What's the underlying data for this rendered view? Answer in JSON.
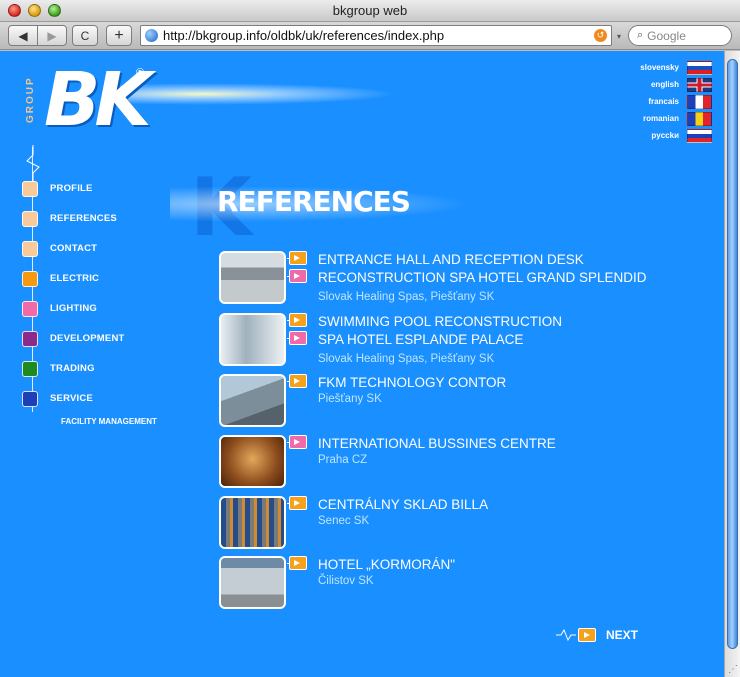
{
  "window": {
    "title": "bkgroup web"
  },
  "toolbar": {
    "back_label": "◀",
    "forward_label": "▶",
    "reload_label": "C",
    "add_label": "+",
    "url": "http://bkgroup.info/oldbk/uk/references/index.php",
    "search_placeholder": "Google"
  },
  "logo": {
    "group": "GROUP",
    "mark": "BK",
    "registered": "®"
  },
  "languages": [
    {
      "label": "slovensky",
      "flag": "flag-sk"
    },
    {
      "label": "english",
      "flag": "flag-gb"
    },
    {
      "label": "francais",
      "flag": "flag-fr"
    },
    {
      "label": "romanian",
      "flag": "flag-ro"
    },
    {
      "label": "pycckи",
      "flag": "flag-ru"
    }
  ],
  "nav": {
    "items": [
      {
        "label": "PROFILE",
        "color": "#f8c99a"
      },
      {
        "label": "REFERENCES",
        "color": "#f8c99a"
      },
      {
        "label": "CONTACT",
        "color": "#f8c99a"
      },
      {
        "label": "ELECTRIC",
        "color": "#f59a10"
      },
      {
        "label": "LIGHTING",
        "color": "#f06aa8"
      },
      {
        "label": "DEVELOPMENT",
        "color": "#8a2a8c"
      },
      {
        "label": "TRADING",
        "color": "#1f8a22"
      },
      {
        "label": "SERVICE",
        "color": "#1d3fb8"
      }
    ],
    "service_sub": "FACILITY MANAGEMENT"
  },
  "heading": {
    "watermark": "K",
    "title": "REFERENCES"
  },
  "references": [
    {
      "lines": [
        "ENTRANCE HALL AND RECEPTION DESK",
        "RECONSTRUCTION SPA HOTEL GRAND SPLENDID"
      ],
      "arrows": [
        "orange",
        "pink"
      ],
      "location": "Slovak Healing Spas, Piešťany SK",
      "thumb": "th1"
    },
    {
      "lines": [
        "SWIMMING POOL RECONSTRUCTION",
        "SPA HOTEL ESPLANDE PALACE"
      ],
      "arrows": [
        "orange",
        "pink"
      ],
      "location": "Slovak Healing Spas, Piešťany SK",
      "thumb": "th2"
    },
    {
      "lines": [
        "FKM TECHNOLOGY CONTOR"
      ],
      "arrows": [
        "orange"
      ],
      "location": "Piešťany SK",
      "thumb": "th3"
    },
    {
      "lines": [
        "INTERNATIONAL BUSSINES CENTRE"
      ],
      "arrows": [
        "pink"
      ],
      "location": "Praha CZ",
      "thumb": "th4"
    },
    {
      "lines": [
        "CENTRÁLNY SKLAD BILLA"
      ],
      "arrows": [
        "orange"
      ],
      "location": "Senec SK",
      "thumb": "th5"
    },
    {
      "lines": [
        "HOTEL „KORMORÁN\""
      ],
      "arrows": [
        "orange"
      ],
      "location": "Čilistov SK",
      "thumb": "th6"
    }
  ],
  "next": {
    "label": "NEXT"
  },
  "colors": {
    "page_background": "#1a8fff",
    "accent_orange": "#f5a11c",
    "accent_pink": "#f06aa8"
  }
}
